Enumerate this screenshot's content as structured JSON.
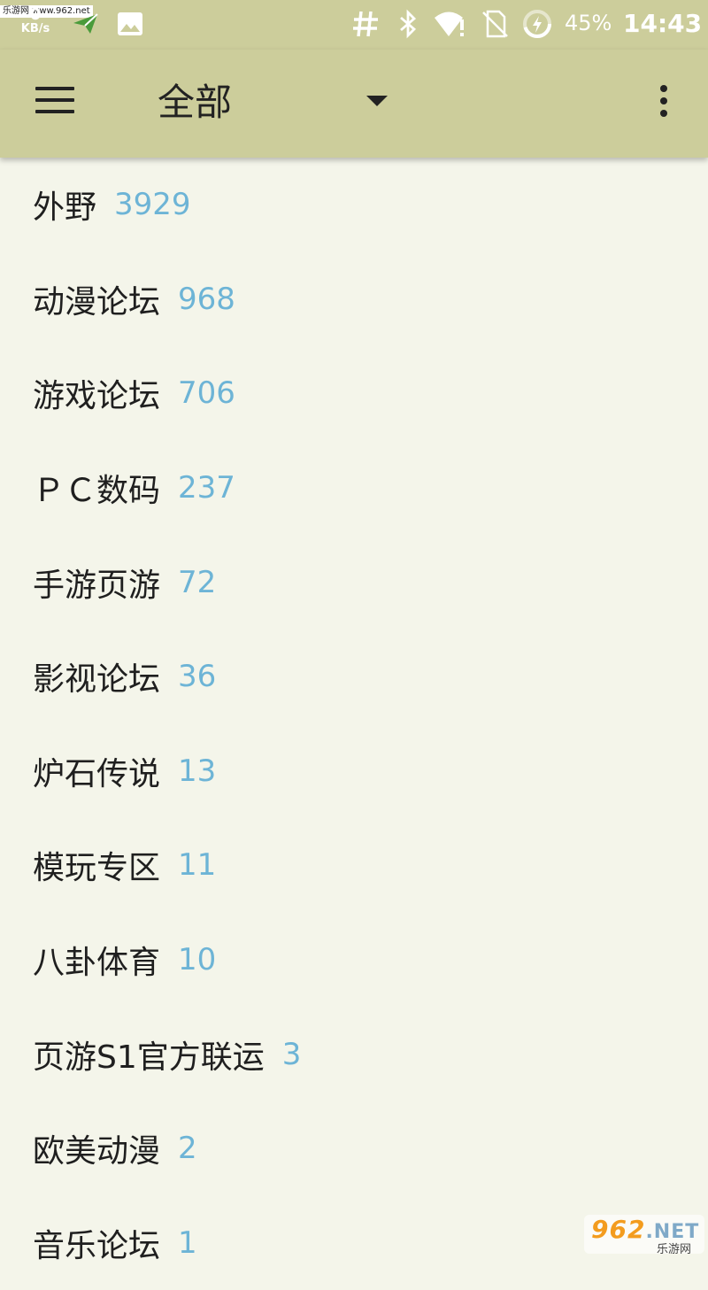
{
  "status_bar": {
    "watermark": "乐游网 www.962.net",
    "net_speed_value": "0",
    "net_speed_unit": "KB/s",
    "battery_percent": "45%",
    "time": "14:43",
    "icons": [
      "send-icon",
      "image-icon",
      "hash-icon",
      "bluetooth-icon",
      "wifi-alert-icon",
      "no-sim-icon",
      "battery-charging-icon"
    ]
  },
  "app_bar": {
    "title": "全部"
  },
  "forums": [
    {
      "name": "外野",
      "count": "3929"
    },
    {
      "name": "动漫论坛",
      "count": "968"
    },
    {
      "name": "游戏论坛",
      "count": "706"
    },
    {
      "name": "ＰＣ数码",
      "count": "237"
    },
    {
      "name": "手游页游",
      "count": "72"
    },
    {
      "name": "影视论坛",
      "count": "36"
    },
    {
      "name": "炉石传说",
      "count": "13"
    },
    {
      "name": "模玩专区",
      "count": "11"
    },
    {
      "name": "八卦体育",
      "count": "10"
    },
    {
      "name": "页游S1官方联运",
      "count": "3"
    },
    {
      "name": "欧美动漫",
      "count": "2"
    },
    {
      "name": "音乐论坛",
      "count": "1"
    }
  ],
  "watermark_logo": {
    "brand": "962",
    "suffix": ".NET",
    "subtitle": "乐游网"
  },
  "colors": {
    "bar": "#cccd9b",
    "background": "#f4f5ea",
    "count": "#6db4d6"
  }
}
